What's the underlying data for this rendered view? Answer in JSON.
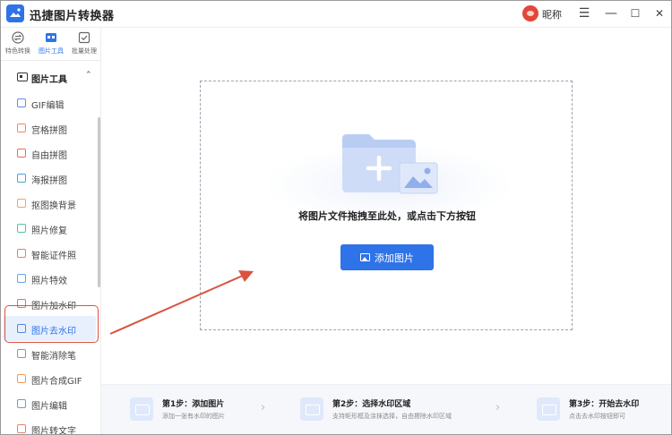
{
  "app": {
    "title": "迅捷图片转换器",
    "accent": "#2e73e8"
  },
  "user": {
    "name": "昵称"
  },
  "window_controls": {
    "menu": "☰",
    "minimize": "—",
    "maximize": "☐",
    "close": "✕"
  },
  "tabs": [
    {
      "label": "特色转换",
      "icon": "swap-icon"
    },
    {
      "label": "图片工具",
      "icon": "image-tools-icon",
      "active": true
    },
    {
      "label": "批量处理",
      "icon": "batch-icon"
    }
  ],
  "section": {
    "label": "图片工具"
  },
  "menu": [
    {
      "label": "GIF编辑",
      "icon": "gif-edit-icon",
      "color": "#5b8ee6"
    },
    {
      "label": "宫格拼图",
      "icon": "grid-puzzle-icon",
      "color": "#f08a5d"
    },
    {
      "label": "自由拼图",
      "icon": "free-puzzle-icon",
      "color": "#e96b5b"
    },
    {
      "label": "海报拼图",
      "icon": "poster-puzzle-icon",
      "color": "#4aa3d9"
    },
    {
      "label": "抠图换背景",
      "icon": "cutout-icon",
      "color": "#f2a65a"
    },
    {
      "label": "照片修复",
      "icon": "photo-repair-icon",
      "color": "#5bc0a0"
    },
    {
      "label": "智能证件照",
      "icon": "id-photo-icon",
      "color": "#f07c5a"
    },
    {
      "label": "照片特效",
      "icon": "photo-effect-icon",
      "color": "#6aa1ea"
    },
    {
      "label": "图片加水印",
      "icon": "add-watermark-icon",
      "color": "#e86b6b"
    },
    {
      "label": "图片去水印",
      "icon": "remove-watermark-icon",
      "color": "#4f86e4",
      "active": true
    },
    {
      "label": "智能消除笔",
      "icon": "eraser-pen-icon",
      "color": "#5cb87a"
    },
    {
      "label": "图片合成GIF",
      "icon": "compose-gif-icon",
      "color": "#f1995b"
    },
    {
      "label": "图片编辑",
      "icon": "image-edit-icon",
      "color": "#58a6e0"
    },
    {
      "label": "图片转文字",
      "icon": "image-to-text-icon",
      "color": "#e7836a"
    }
  ],
  "dropzone": {
    "hint": "将图片文件拖拽至此处，或点击下方按钮",
    "button_label": "添加图片"
  },
  "steps": [
    {
      "title": "第1步：添加图片",
      "desc": "添加一张有水印的图片"
    },
    {
      "title": "第2步：选择水印区域",
      "desc": "支持矩形框及涂抹选择，自由擦除水印区域"
    },
    {
      "title": "第3步：开始去水印",
      "desc": "点击去水印按钮即可"
    }
  ],
  "colors": {
    "highlight": "#d9533f",
    "step_arrow": "#b8bcc4"
  }
}
